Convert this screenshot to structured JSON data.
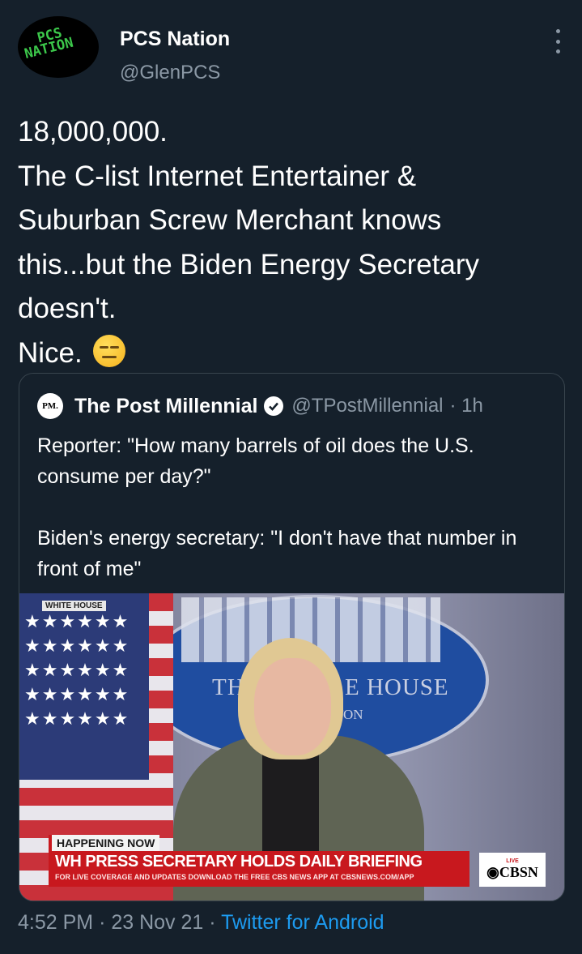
{
  "author": {
    "avatar_text_line1": "PCS",
    "avatar_text_line2": "NATION",
    "name": "PCS Nation",
    "handle": "@GlenPCS"
  },
  "tweet": {
    "text": "18,000,000.\nThe C-list Internet Entertainer &\nSuburban Screw Merchant knows\nthis...but the Biden Energy Secretary\ndoesn't.\nNice. ",
    "emoji": "expressionless-face"
  },
  "quoted_tweet": {
    "logo_text": "PM.",
    "name": "The Post Millennial",
    "handle": "@TPostMillennial",
    "time": "· 1h",
    "text": "Reporter: \"How many barrels of oil does the U.S. consume per day?\"\n\nBiden's energy secretary: \"I don't have that number in front of me\"",
    "media": {
      "corner_tag": "WHITE HOUSE",
      "seal_text_left": "THE",
      "seal_text_right": "E HOUSE",
      "seal_text_sub": "IGTON",
      "happening_now": "HAPPENING NOW",
      "headline": "WH PRESS SECRETARY HOLDS DAILY BRIEFING",
      "subline": "FOR LIVE COVERAGE AND UPDATES DOWNLOAD THE FREE CBS NEWS APP AT CBSNEWS.COM/APP",
      "network_live": "LIVE",
      "network": "◉CBSN"
    }
  },
  "footer": {
    "time": "4:52 PM",
    "date": "23 Nov 21",
    "separator": "·",
    "app": "Twitter for Android"
  },
  "colors": {
    "background": "#15202b",
    "secondary_text": "#8b98a5",
    "link": "#1d9bf0",
    "border": "#38444d"
  }
}
